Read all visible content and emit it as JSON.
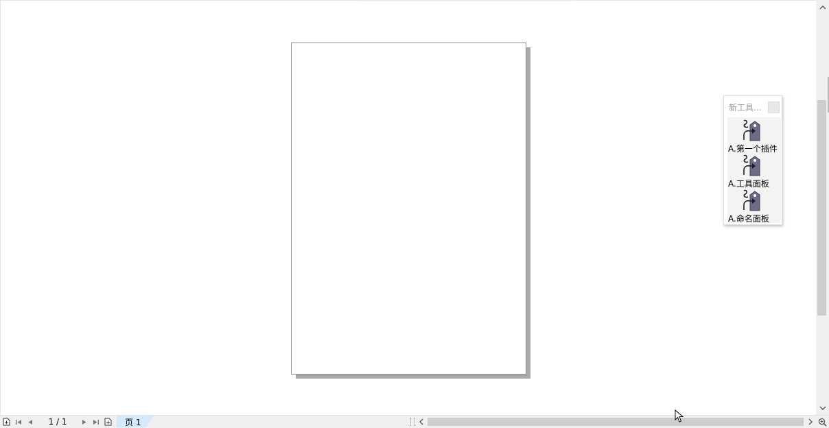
{
  "toolbox": {
    "title": "新工具...",
    "items": [
      {
        "label": "A.第一个插件",
        "icon": "tag-plugin-icon"
      },
      {
        "label": "A.工具面板",
        "icon": "tag-plugin-icon"
      },
      {
        "label": "A.命名面板",
        "icon": "tag-plugin-icon"
      }
    ]
  },
  "page_nav": {
    "counter": "1 / 1",
    "tab_label": "页 1"
  },
  "colors": {
    "page_tab_bg": "#d6e8fb",
    "icon_body": "#6b6c86",
    "scroll_thumb": "#cdcdcd"
  }
}
